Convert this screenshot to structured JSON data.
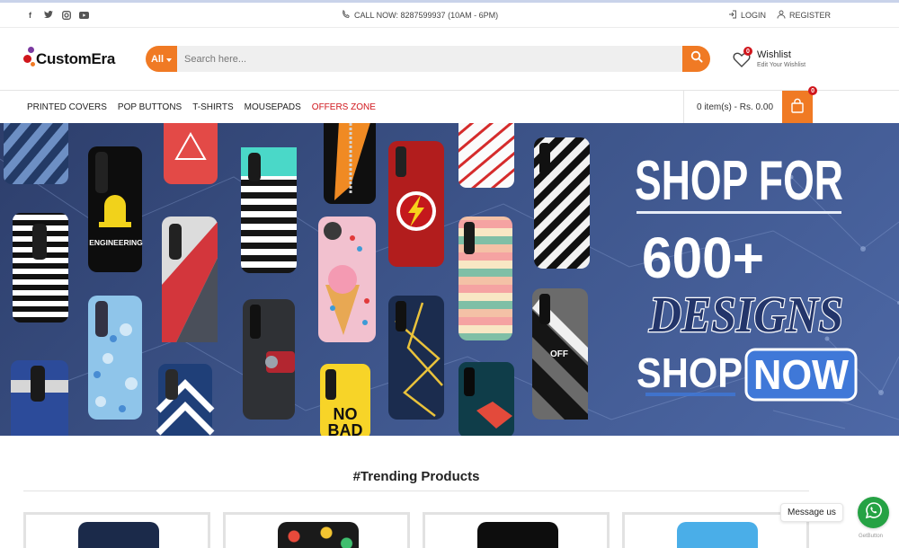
{
  "topbar": {
    "social_icons": [
      "facebook-icon",
      "twitter-icon",
      "instagram-icon",
      "youtube-icon"
    ],
    "call_now": "CALL NOW: 8287599937 (10AM - 6PM)",
    "login": "LOGIN",
    "register": "REGISTER"
  },
  "header": {
    "logo_text": "CustomEra",
    "search": {
      "category": "All",
      "placeholder": "Search here..."
    },
    "wishlist": {
      "count": "0",
      "title": "Wishlist",
      "subtitle": "Edit Your Wishlist"
    }
  },
  "nav": {
    "items": [
      "PRINTED COVERS",
      "POP BUTTONS",
      "T-SHIRTS",
      "MOUSEPADS",
      "OFFERS ZONE"
    ],
    "cart": {
      "summary": "0 item(s) - Rs. 0.00",
      "count": "0"
    }
  },
  "banner": {
    "line1": "SHOP FOR",
    "line2": "600+",
    "line3": "DESIGNS",
    "shop": "SHOP",
    "now": "NOW",
    "case_texts": {
      "engineering": "ENGINEERING",
      "no": "NO",
      "bad": "BAD",
      "off": "OFF"
    }
  },
  "trending": {
    "title": "#Trending Products"
  },
  "chat": {
    "message_label": "Message us",
    "footer": "GetButton"
  },
  "colors": {
    "accent": "#f07a24",
    "badge": "#d0161c",
    "whatsapp": "#25a244",
    "offers": "#d0161c"
  }
}
